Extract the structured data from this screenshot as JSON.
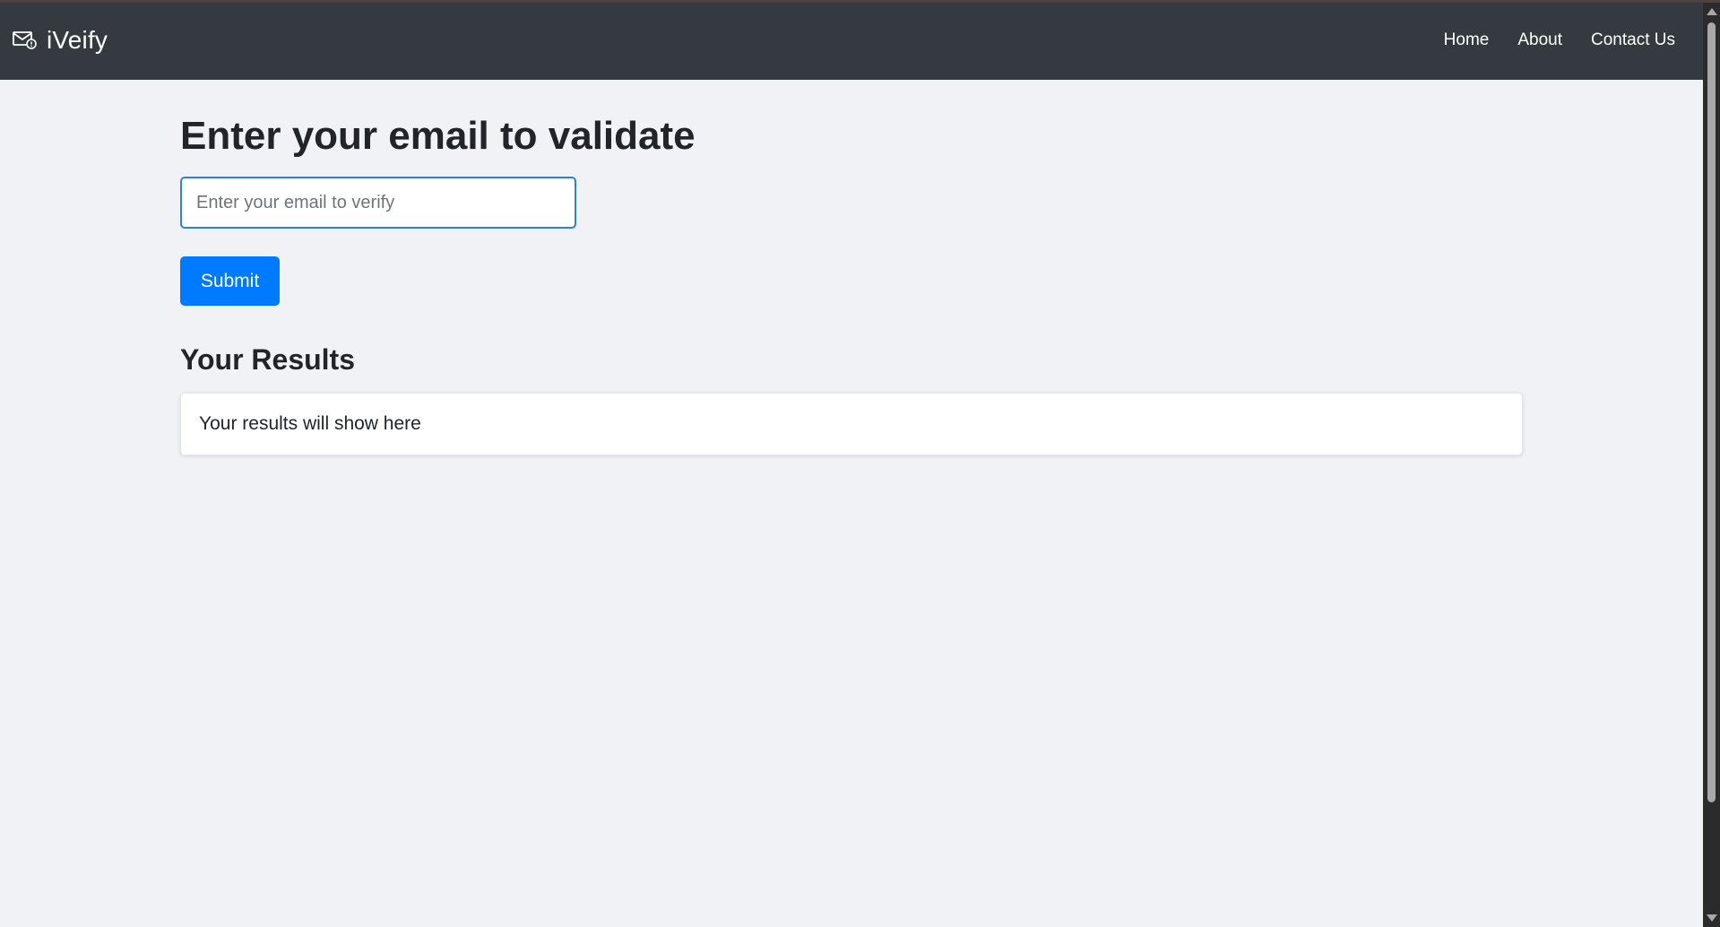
{
  "brand": {
    "name": "iVeify",
    "icon": "envelope-icon"
  },
  "nav": {
    "items": [
      {
        "label": "Home"
      },
      {
        "label": "About"
      },
      {
        "label": "Contact Us"
      }
    ]
  },
  "form": {
    "heading": "Enter your email to validate",
    "email_placeholder": "Enter your email to verify",
    "email_value": "",
    "submit_label": "Submit"
  },
  "results": {
    "heading": "Your Results",
    "placeholder_text": "Your results will show here"
  },
  "colors": {
    "navbar": "#343a40",
    "background": "#f0f2f5",
    "primary": "#007bff"
  }
}
